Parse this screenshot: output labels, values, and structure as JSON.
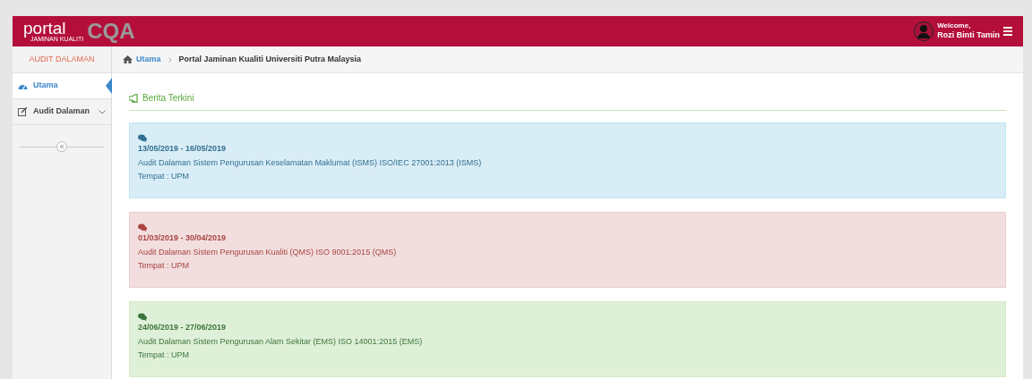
{
  "header": {
    "logo": {
      "word": "portal",
      "subtitle": "JAMINAN KUALITI",
      "mark": "CQA"
    },
    "user": {
      "greeting": "Welcome,",
      "name": "Rozi Binti Tamin"
    }
  },
  "sidebar": {
    "title": "AUDIT DALAMAN",
    "items": [
      {
        "label": "Utama",
        "selected": true,
        "expandable": false
      },
      {
        "label": "Audit Dalaman",
        "selected": false,
        "expandable": true
      }
    ]
  },
  "breadcrumb": [
    "Utama",
    "Portal Jaminan Kualiti Universiti Putra Malaysia"
  ],
  "section": {
    "title": "Berita Terkini"
  },
  "notices": [
    {
      "kind": "info",
      "dates": "13/05/2019 - 16/05/2019",
      "title": "Audit Dalaman Sistem Pengurusan Keselamatan Maklumat (ISMS) ISO/IEC 27001:2013 (ISMS)",
      "place": "Tempat : UPM"
    },
    {
      "kind": "danger",
      "dates": "01/03/2019 - 30/04/2019",
      "title": "Audit Dalaman Sistem Pengurusan Kualiti (QMS) ISO 9001:2015 (QMS)",
      "place": "Tempat : UPM"
    },
    {
      "kind": "success",
      "dates": "24/06/2019 - 27/06/2019",
      "title": "Audit Dalaman Sistem Pengurusan Alam Sekitar (EMS) ISO 14001:2015 (EMS)",
      "place": "Tempat : UPM"
    }
  ]
}
